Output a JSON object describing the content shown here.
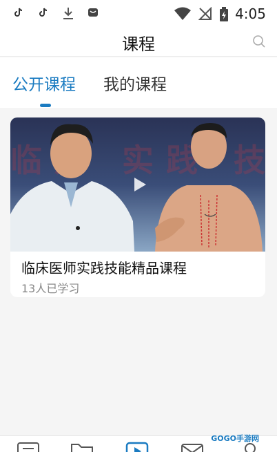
{
  "status_bar": {
    "time": "4:05",
    "icons": [
      "tiktok-icon",
      "tiktok-icon",
      "download-icon",
      "app-icon",
      "wifi-icon",
      "no-signal-icon",
      "battery-charging-icon"
    ]
  },
  "header": {
    "title": "课程",
    "search_icon": "search-icon"
  },
  "tabs": {
    "items": [
      {
        "label": "公开课程",
        "active": true
      },
      {
        "label": "我的课程",
        "active": false
      }
    ],
    "accent_color": "#1a7bc1"
  },
  "courses": [
    {
      "title": "临床医师实践技能精品课程",
      "learners": "13人已学习",
      "thumbnail_text": "临床  实践  技能",
      "play_icon": "play-icon"
    }
  ],
  "bottom_nav": {
    "icons": [
      "list-icon",
      "folder-icon",
      "play-icon",
      "mail-icon",
      "user-icon"
    ],
    "active_index": 2
  },
  "watermark": "GOGO手游网"
}
